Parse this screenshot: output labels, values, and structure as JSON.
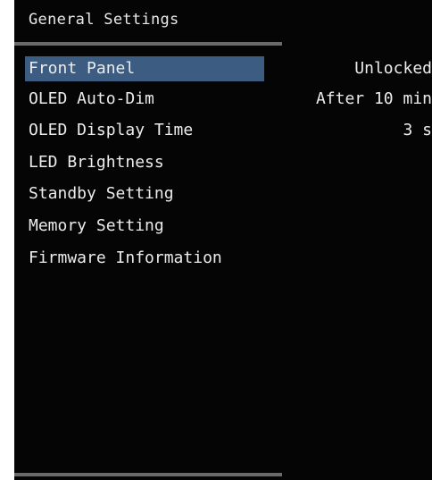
{
  "header": {
    "title": "General Settings"
  },
  "menu": {
    "items": [
      {
        "label": "Front Panel",
        "value": "Unlocked",
        "selected": true
      },
      {
        "label": "OLED Auto-Dim",
        "value": "After 10 min",
        "selected": false
      },
      {
        "label": "OLED Display Time",
        "value": "3 s",
        "selected": false
      },
      {
        "label": "LED Brightness",
        "value": "",
        "selected": false
      },
      {
        "label": "Standby Setting",
        "value": "",
        "selected": false
      },
      {
        "label": "Memory Setting",
        "value": "",
        "selected": false
      },
      {
        "label": "Firmware Information",
        "value": "",
        "selected": false
      }
    ]
  },
  "colors": {
    "background": "#050505",
    "text": "#ececec",
    "selection": "#3c5d81",
    "divider": "#6a6a6a"
  }
}
